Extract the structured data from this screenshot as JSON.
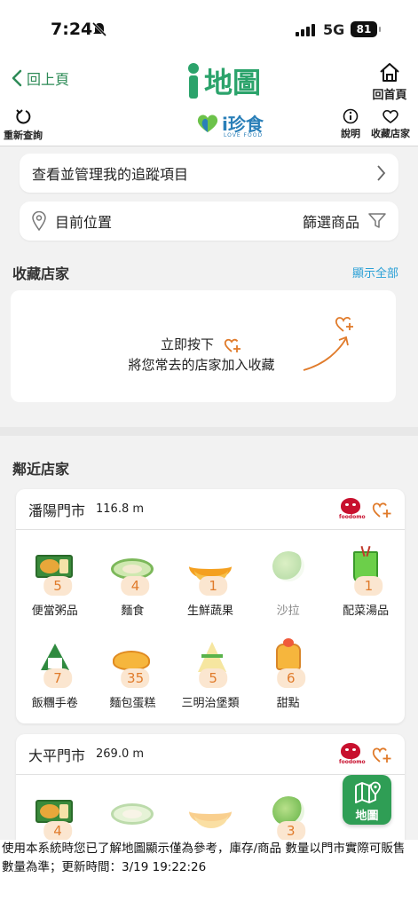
{
  "status_bar": {
    "time": "7:24",
    "network": "5G",
    "battery": "81"
  },
  "header": {
    "back_label": "回上頁",
    "logo_text": "地圖",
    "home_label": "回首頁",
    "refresh_label": "重新查詢",
    "brand_text": "i珍食",
    "brand_sub": "LOVE FOOD",
    "info_label": "說明",
    "favorites_label": "收藏店家"
  },
  "tracking": {
    "label": "查看並管理我的追蹤項目"
  },
  "location": {
    "label": "目前位置",
    "filter_label": "篩選商品"
  },
  "favorites_section": {
    "title": "收藏店家",
    "show_all": "顯示全部",
    "prompt_line1": "立即按下",
    "prompt_line2": "將您常去的店家加入收藏"
  },
  "nearby_section": {
    "title": "鄰近店家"
  },
  "stores": [
    {
      "name": "潘陽門市",
      "distance": "116.8 m",
      "partner": "foodomo",
      "categories": [
        {
          "label": "便當粥品",
          "count": "5",
          "icon": "bento-icon"
        },
        {
          "label": "麵食",
          "count": "4",
          "icon": "noodle-icon"
        },
        {
          "label": "生鮮蔬果",
          "count": "1",
          "icon": "banana-icon"
        },
        {
          "label": "沙拉",
          "count": "",
          "icon": "salad-icon"
        },
        {
          "label": "配菜湯品",
          "count": "1",
          "icon": "soup-cup-icon"
        },
        {
          "label": "飯糰手卷",
          "count": "7",
          "icon": "onigiri-icon"
        },
        {
          "label": "麵包蛋糕",
          "count": "35",
          "icon": "bread-icon"
        },
        {
          "label": "三明治堡類",
          "count": "5",
          "icon": "sandwich-icon"
        },
        {
          "label": "甜點",
          "count": "6",
          "icon": "dessert-icon"
        }
      ]
    },
    {
      "name": "大平門市",
      "distance": "269.0 m",
      "partner": "foodomo",
      "categories": [
        {
          "label": "",
          "count": "4",
          "icon": "bento-icon"
        },
        {
          "label": "",
          "count": "",
          "icon": "noodle-icon"
        },
        {
          "label": "",
          "count": "",
          "icon": "banana-icon"
        },
        {
          "label": "",
          "count": "3",
          "icon": "salad-icon"
        }
      ]
    }
  ],
  "map_button": {
    "label": "地圖"
  },
  "footer_note": "使用本系統時您已了解地圖顯示僅為參考，庫存/商品 數量以門市實際可販售數量為準；更新時間：3/19 19:22:26",
  "colors": {
    "brand_green": "#2ba36b",
    "badge_bg": "#fbe6d0",
    "badge_text": "#e07b2b",
    "link_blue": "#2aa0d6",
    "accent_orange": "#e07b2b"
  }
}
